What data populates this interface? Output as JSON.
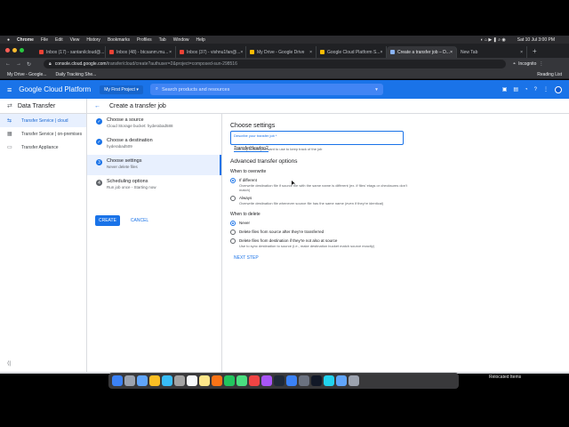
{
  "mac_menu": {
    "app": "Chrome",
    "items": [
      "File",
      "Edit",
      "View",
      "History",
      "Bookmarks",
      "Profiles",
      "Tab",
      "Window",
      "Help"
    ],
    "clock": "Sat 10 Jul  3:00 PM"
  },
  "tabs": [
    {
      "label": "Inbox (17) - santanilcloud@..."
    },
    {
      "label": "Inbox (48) - btcsanm.mu..."
    },
    {
      "label": "Inbox (37) - vishnu1fan@..."
    },
    {
      "label": "My Drive - Google Drive"
    },
    {
      "label": "Google Cloud Platform S..."
    },
    {
      "label": "Create a transfer job – D..."
    },
    {
      "label": "New Tab"
    }
  ],
  "address": {
    "host": "console.cloud.google.com",
    "path": "/transfer/cloud/create?authuser=2&project=composed-sun-298516",
    "incognito_label": "Incognito"
  },
  "bookmarks": {
    "items": [
      "My Drive - Google...",
      "Daily Tracking She..."
    ],
    "reading_list": "Reading List"
  },
  "gcp": {
    "brand": "Google Cloud Platform",
    "project": "My First Project",
    "search_placeholder": "Search products and resources"
  },
  "sidebar": {
    "title": "Data Transfer",
    "items": [
      {
        "label": "Transfer Service | cloud",
        "icon": "transfer-icon"
      },
      {
        "label": "Transfer Service | on-premises",
        "icon": "server-icon"
      },
      {
        "label": "Transfer Appliance",
        "icon": "appliance-icon"
      }
    ]
  },
  "page": {
    "title": "Create a transfer job"
  },
  "steps": [
    {
      "title": "Choose a source",
      "subtitle": "Cloud Storage bucket: hyderabad588",
      "marker": "✓"
    },
    {
      "title": "Choose a destination",
      "subtitle": "hyderabad509",
      "marker": "✓"
    },
    {
      "title": "Choose settings",
      "subtitle": "Never delete files",
      "marker": "3"
    },
    {
      "title": "Scheduling options",
      "subtitle": "Run job once - Starting now",
      "marker": "4"
    }
  ],
  "actions": {
    "create": "CREATE",
    "cancel": "CANCEL"
  },
  "settings": {
    "heading": "Choose settings",
    "field_label": "Describe your transfer job *",
    "field_value": "TransferHeadno2",
    "field_hint": "Note any details you want to use to keep track of the job",
    "advanced_heading": "Advanced transfer options",
    "overwrite_heading": "When to overwrite",
    "overwrite_options": [
      {
        "label": "If different",
        "desc": "Overwrite destination file if source file with the same name is different (ex. if files' etags or checksums don't match)",
        "checked": true
      },
      {
        "label": "Always",
        "desc": "Overwrite destination file whenever source file has the same name (even if they're identical)",
        "checked": false
      }
    ],
    "delete_heading": "When to delete",
    "delete_options": [
      {
        "label": "Never",
        "desc": "",
        "checked": true
      },
      {
        "label": "Delete files from source after they're transferred",
        "desc": "",
        "checked": false
      },
      {
        "label": "Delete files from destination if they're not also at source",
        "desc": "Use to sync destination to source (i.e., make destination bucket match source exactly)",
        "checked": false
      }
    ],
    "next_step": "NEXT STEP"
  },
  "dock": {
    "relocated_label": "Relocated Items"
  },
  "colors": {
    "gcp_blue": "#1a73e8",
    "chrome_dark": "#35363a"
  }
}
